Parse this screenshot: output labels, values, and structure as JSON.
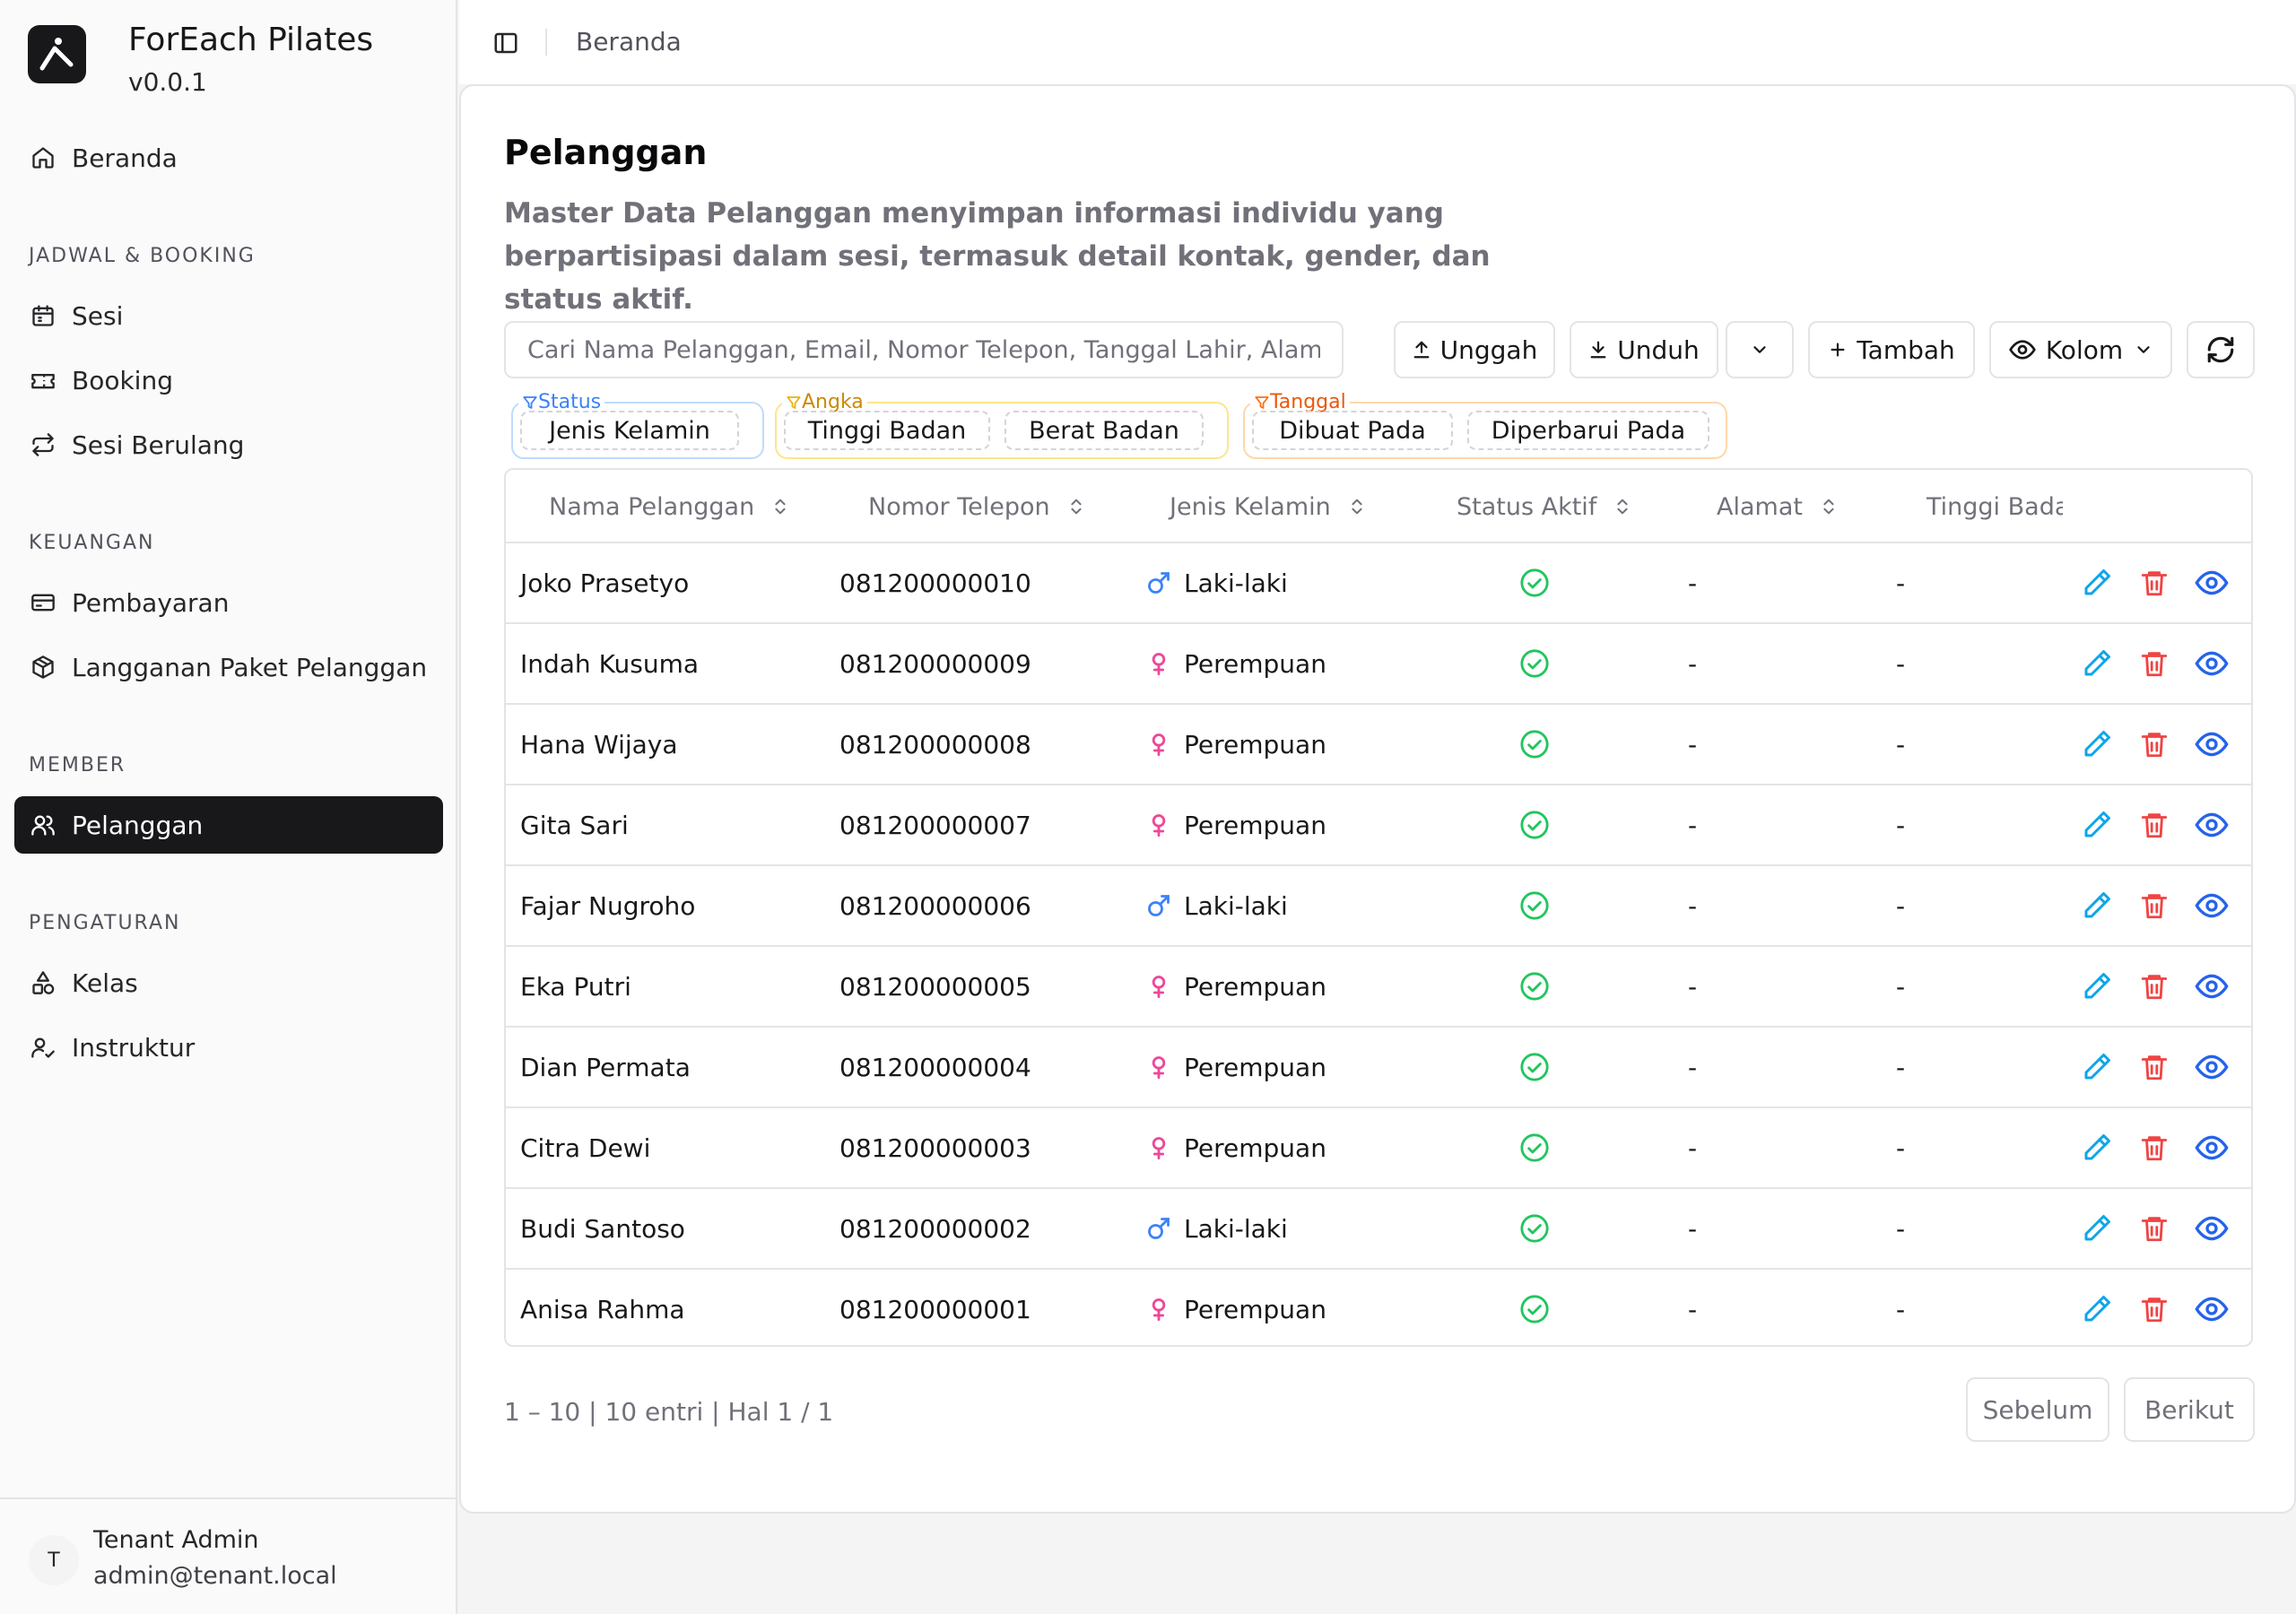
{
  "brand": {
    "name": "ForEach Pilates",
    "version": "v0.0.1"
  },
  "sidebar": {
    "home": "Beranda",
    "groups": [
      {
        "title": "JADWAL & BOOKING",
        "items": [
          "Sesi",
          "Booking",
          "Sesi Berulang"
        ]
      },
      {
        "title": "KEUANGAN",
        "items": [
          "Pembayaran",
          "Langganan Paket Pelanggan"
        ]
      },
      {
        "title": "MEMBER",
        "items": [
          "Pelanggan"
        ]
      },
      {
        "title": "PENGATURAN",
        "items": [
          "Kelas",
          "Instruktur"
        ]
      }
    ],
    "active": "Pelanggan"
  },
  "user": {
    "initial": "T",
    "name": "Tenant Admin",
    "email": "admin@tenant.local"
  },
  "breadcrumb": "Beranda",
  "page": {
    "title": "Pelanggan",
    "description": "Master Data Pelanggan menyimpan informasi individu yang berpartisipasi dalam sesi, termasuk detail kontak, gender, dan status aktif."
  },
  "toolbar": {
    "search_placeholder": "Cari Nama Pelanggan, Email, Nomor Telepon, Tanggal Lahir, Alamat, Riwayat Medis",
    "upload": "Unggah",
    "download": "Unduh",
    "add": "Tambah",
    "columns": "Kolom"
  },
  "filters": {
    "status": {
      "label": "Status",
      "color": "#3b82f6",
      "chips": [
        "Jenis Kelamin"
      ]
    },
    "number": {
      "label": "Angka",
      "color": "#eab308",
      "chips": [
        "Tinggi Badan",
        "Berat Badan"
      ]
    },
    "date": {
      "label": "Tanggal",
      "color": "#f97316",
      "chips": [
        "Dibuat Pada",
        "Diperbarui Pada"
      ]
    }
  },
  "table": {
    "columns": [
      "Nama Pelanggan",
      "Nomor Telepon",
      "Jenis Kelamin",
      "Status Aktif",
      "Alamat",
      "Tinggi Bada"
    ],
    "rows": [
      {
        "name": "Joko Prasetyo",
        "phone": "081200000010",
        "gender": "Laki-laki",
        "gender_icon": "male-icon",
        "active": true,
        "address": "-",
        "height": "-"
      },
      {
        "name": "Indah Kusuma",
        "phone": "081200000009",
        "gender": "Perempuan",
        "gender_icon": "female-icon",
        "active": true,
        "address": "-",
        "height": "-"
      },
      {
        "name": "Hana Wijaya",
        "phone": "081200000008",
        "gender": "Perempuan",
        "gender_icon": "female-icon",
        "active": true,
        "address": "-",
        "height": "-"
      },
      {
        "name": "Gita Sari",
        "phone": "081200000007",
        "gender": "Perempuan",
        "gender_icon": "female-icon",
        "active": true,
        "address": "-",
        "height": "-"
      },
      {
        "name": "Fajar Nugroho",
        "phone": "081200000006",
        "gender": "Laki-laki",
        "gender_icon": "male-icon",
        "active": true,
        "address": "-",
        "height": "-"
      },
      {
        "name": "Eka Putri",
        "phone": "081200000005",
        "gender": "Perempuan",
        "gender_icon": "female-icon",
        "active": true,
        "address": "-",
        "height": "-"
      },
      {
        "name": "Dian Permata",
        "phone": "081200000004",
        "gender": "Perempuan",
        "gender_icon": "female-icon",
        "active": true,
        "address": "-",
        "height": "-"
      },
      {
        "name": "Citra Dewi",
        "phone": "081200000003",
        "gender": "Perempuan",
        "gender_icon": "female-icon",
        "active": true,
        "address": "-",
        "height": "-"
      },
      {
        "name": "Budi Santoso",
        "phone": "081200000002",
        "gender": "Laki-laki",
        "gender_icon": "male-icon",
        "active": true,
        "address": "-",
        "height": "-"
      },
      {
        "name": "Anisa Rahma",
        "phone": "081200000001",
        "gender": "Perempuan",
        "gender_icon": "female-icon",
        "active": true,
        "address": "-",
        "height": "-"
      }
    ]
  },
  "pagination": {
    "info": "1 – 10 | 10 entri | Hal 1 / 1",
    "prev": "Sebelum",
    "next": "Berikut"
  },
  "colors": {
    "male": "#3b82f6",
    "female": "#ec4899",
    "active": "#22c55e",
    "edit": "#0ea5e9",
    "delete": "#ef4444",
    "view": "#2563eb"
  }
}
